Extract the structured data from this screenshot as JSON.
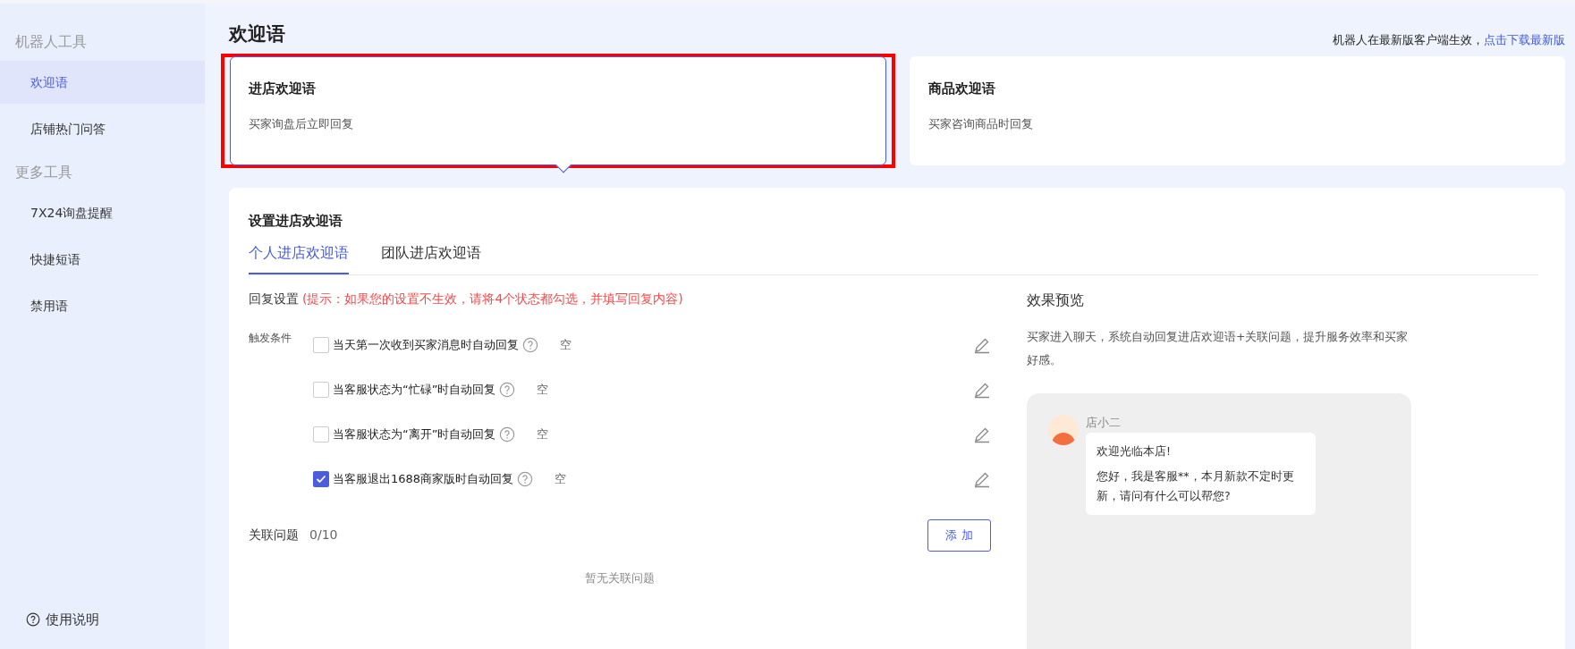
{
  "sidebar": {
    "sections": [
      {
        "title": "机器人工具",
        "items": [
          {
            "label": "欢迎语",
            "selected": true
          },
          {
            "label": "店铺热门问答",
            "selected": false
          }
        ]
      },
      {
        "title": "更多工具",
        "items": [
          {
            "label": "7X24询盘提醒",
            "selected": false
          },
          {
            "label": "快捷短语",
            "selected": false
          },
          {
            "label": "禁用语",
            "selected": false
          }
        ]
      }
    ],
    "help_link": "使用说明"
  },
  "header": {
    "title": "欢迎语",
    "notice": "机器人在最新版客户端生效，",
    "notice_link": "点击下载最新版"
  },
  "type_cards": [
    {
      "title": "进店欢迎语",
      "subtitle": "买家询盘后立即回复",
      "selected": true,
      "highlighted": true
    },
    {
      "title": "商品欢迎语",
      "subtitle": "买家咨询商品时回复",
      "selected": false,
      "highlighted": false
    }
  ],
  "settings": {
    "title": "设置进店欢迎语",
    "tabs": [
      {
        "label": "个人进店欢迎语",
        "selected": true
      },
      {
        "label": "团队进店欢迎语",
        "selected": false
      }
    ],
    "reply_label": "回复设置",
    "reply_hint": "(提示：如果您的设置不生效，请将4个状态都勾选，并填写回复内容)",
    "trigger_label": "触发条件",
    "triggers": [
      {
        "label": "当天第一次收到买家消息时自动回复",
        "checked": false,
        "value": "空"
      },
      {
        "label": "当客服状态为“忙碌”时自动回复",
        "checked": false,
        "value": "空"
      },
      {
        "label": "当客服状态为“离开”时自动回复",
        "checked": false,
        "value": "空"
      },
      {
        "label": "当客服退出1688商家版时自动回复",
        "checked": true,
        "value": "空"
      }
    ],
    "related_label": "关联问题",
    "related_count": "0",
    "related_max": "/10",
    "add_button": "添 加",
    "empty_text": "暂无关联问题"
  },
  "preview": {
    "title": "效果预览",
    "description": "买家进入聊天，系统自动回复进店欢迎语+关联问题，提升服务效率和买家好感。",
    "sender": "店小二",
    "messages": [
      "欢迎光临本店!",
      "您好，我是客服**，本月新款不定时更新，请问有什么可以帮您?"
    ]
  }
}
